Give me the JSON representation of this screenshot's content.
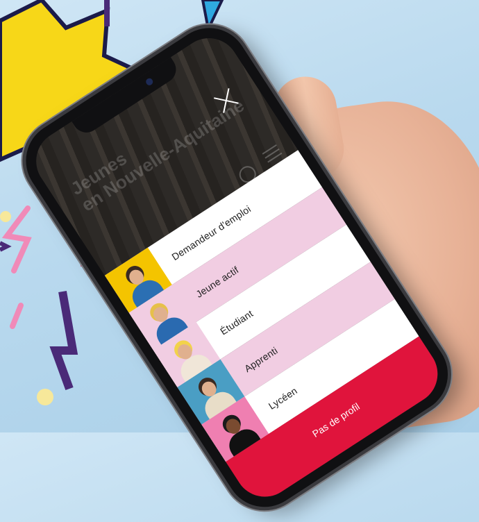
{
  "background_site": {
    "title_line1": "Jeunes",
    "title_line2": "en Nouvelle-Aquitaine"
  },
  "menu": {
    "items": [
      {
        "label": "Demandeur d'emploi",
        "bg": "#ffffff",
        "thumb_bg": "#f4c400",
        "torso": "#2b6fb3",
        "icon": "person-photo"
      },
      {
        "label": "Jeune actif",
        "bg": "#f1cde2",
        "thumb_bg": "#f1cde2",
        "torso": "#2a6ab0",
        "icon": "person-photo"
      },
      {
        "label": "Étudiant",
        "bg": "#ffffff",
        "thumb_bg": "#f1cde2",
        "torso": "#f0e6d8",
        "icon": "person-photo"
      },
      {
        "label": "Apprenti",
        "bg": "#f1cde2",
        "thumb_bg": "#4a9ec4",
        "torso": "#e8ddc8",
        "icon": "person-photo"
      },
      {
        "label": "Lycéen",
        "bg": "#ffffff",
        "thumb_bg": "#ef7fb1",
        "torso": "#111111",
        "icon": "person-photo"
      }
    ],
    "footer_label": "Pas de profil",
    "footer_color": "#e0143c"
  },
  "colors": {
    "background": "#b9d9ee",
    "star": "#f7d718",
    "accent_purple": "#4a2a78",
    "accent_pink": "#f08ab8",
    "accent_red": "#e0143c"
  }
}
